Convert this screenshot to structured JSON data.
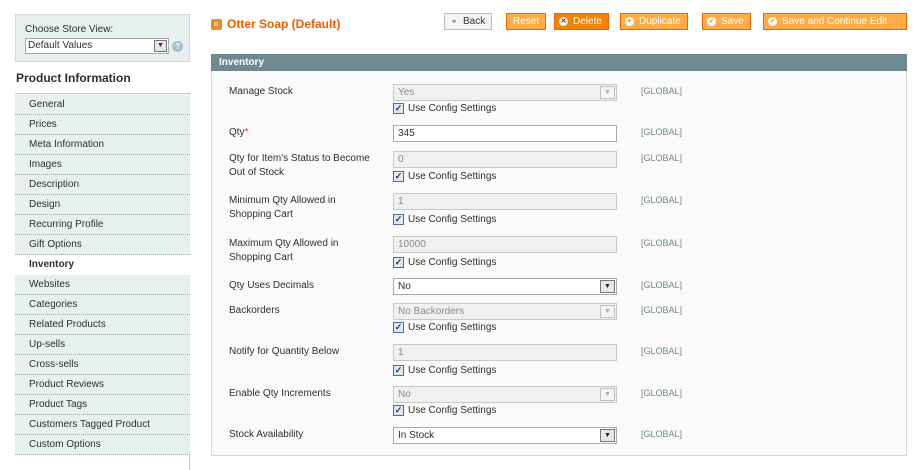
{
  "store_switcher": {
    "label": "Choose Store View:",
    "selected": "Default Values"
  },
  "tabs": {
    "title": "Product Information",
    "items": [
      {
        "label": "General"
      },
      {
        "label": "Prices"
      },
      {
        "label": "Meta Information"
      },
      {
        "label": "Images"
      },
      {
        "label": "Description"
      },
      {
        "label": "Design"
      },
      {
        "label": "Recurring Profile"
      },
      {
        "label": "Gift Options"
      },
      {
        "label": "Inventory",
        "active": true
      },
      {
        "label": "Websites"
      },
      {
        "label": "Categories"
      },
      {
        "label": "Related Products"
      },
      {
        "label": "Up-sells"
      },
      {
        "label": "Cross-sells"
      },
      {
        "label": "Product Reviews"
      },
      {
        "label": "Product Tags"
      },
      {
        "label": "Customers Tagged Product"
      },
      {
        "label": "Custom Options"
      }
    ]
  },
  "header": {
    "title": "Otter Soap (Default)",
    "buttons": {
      "back": "Back",
      "reset": "Reset",
      "delete": "Delete",
      "duplicate": "Duplicate",
      "save": "Save",
      "save_continue": "Save and Continue Edit"
    }
  },
  "section": {
    "title": "Inventory",
    "use_config_label": "Use Config Settings",
    "scope": "[GLOBAL]",
    "fields": {
      "manage_stock": {
        "label": "Manage Stock",
        "value": "Yes",
        "use_config": true
      },
      "qty": {
        "label": "Qty",
        "required_mark": "*",
        "value": "345"
      },
      "out_of_stock": {
        "label": "Qty for Item's Status to Become Out of Stock",
        "value": "0",
        "use_config": true
      },
      "min_qty": {
        "label": "Minimum Qty Allowed in Shopping Cart",
        "value": "1",
        "use_config": true
      },
      "max_qty": {
        "label": "Maximum Qty Allowed in Shopping Cart",
        "value": "10000",
        "use_config": true
      },
      "decimals": {
        "label": "Qty Uses Decimals",
        "value": "No"
      },
      "backorders": {
        "label": "Backorders",
        "value": "No Backorders",
        "use_config": true
      },
      "notify": {
        "label": "Notify for Quantity Below",
        "value": "1",
        "use_config": true
      },
      "qty_increments": {
        "label": "Enable Qty Increments",
        "value": "No",
        "use_config": true
      },
      "stock_availability": {
        "label": "Stock Availability",
        "value": "In Stock"
      }
    }
  }
}
